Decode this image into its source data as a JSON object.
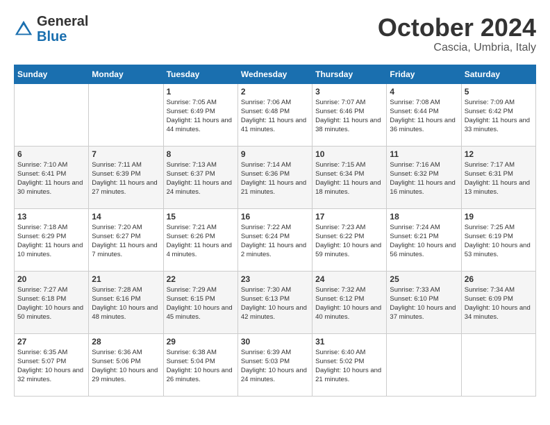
{
  "header": {
    "logo_general": "General",
    "logo_blue": "Blue",
    "month": "October 2024",
    "location": "Cascia, Umbria, Italy"
  },
  "weekdays": [
    "Sunday",
    "Monday",
    "Tuesday",
    "Wednesday",
    "Thursday",
    "Friday",
    "Saturday"
  ],
  "weeks": [
    [
      {
        "day": "",
        "info": ""
      },
      {
        "day": "",
        "info": ""
      },
      {
        "day": "1",
        "info": "Sunrise: 7:05 AM\nSunset: 6:49 PM\nDaylight: 11 hours and 44 minutes."
      },
      {
        "day": "2",
        "info": "Sunrise: 7:06 AM\nSunset: 6:48 PM\nDaylight: 11 hours and 41 minutes."
      },
      {
        "day": "3",
        "info": "Sunrise: 7:07 AM\nSunset: 6:46 PM\nDaylight: 11 hours and 38 minutes."
      },
      {
        "day": "4",
        "info": "Sunrise: 7:08 AM\nSunset: 6:44 PM\nDaylight: 11 hours and 36 minutes."
      },
      {
        "day": "5",
        "info": "Sunrise: 7:09 AM\nSunset: 6:42 PM\nDaylight: 11 hours and 33 minutes."
      }
    ],
    [
      {
        "day": "6",
        "info": "Sunrise: 7:10 AM\nSunset: 6:41 PM\nDaylight: 11 hours and 30 minutes."
      },
      {
        "day": "7",
        "info": "Sunrise: 7:11 AM\nSunset: 6:39 PM\nDaylight: 11 hours and 27 minutes."
      },
      {
        "day": "8",
        "info": "Sunrise: 7:13 AM\nSunset: 6:37 PM\nDaylight: 11 hours and 24 minutes."
      },
      {
        "day": "9",
        "info": "Sunrise: 7:14 AM\nSunset: 6:36 PM\nDaylight: 11 hours and 21 minutes."
      },
      {
        "day": "10",
        "info": "Sunrise: 7:15 AM\nSunset: 6:34 PM\nDaylight: 11 hours and 18 minutes."
      },
      {
        "day": "11",
        "info": "Sunrise: 7:16 AM\nSunset: 6:32 PM\nDaylight: 11 hours and 16 minutes."
      },
      {
        "day": "12",
        "info": "Sunrise: 7:17 AM\nSunset: 6:31 PM\nDaylight: 11 hours and 13 minutes."
      }
    ],
    [
      {
        "day": "13",
        "info": "Sunrise: 7:18 AM\nSunset: 6:29 PM\nDaylight: 11 hours and 10 minutes."
      },
      {
        "day": "14",
        "info": "Sunrise: 7:20 AM\nSunset: 6:27 PM\nDaylight: 11 hours and 7 minutes."
      },
      {
        "day": "15",
        "info": "Sunrise: 7:21 AM\nSunset: 6:26 PM\nDaylight: 11 hours and 4 minutes."
      },
      {
        "day": "16",
        "info": "Sunrise: 7:22 AM\nSunset: 6:24 PM\nDaylight: 11 hours and 2 minutes."
      },
      {
        "day": "17",
        "info": "Sunrise: 7:23 AM\nSunset: 6:22 PM\nDaylight: 10 hours and 59 minutes."
      },
      {
        "day": "18",
        "info": "Sunrise: 7:24 AM\nSunset: 6:21 PM\nDaylight: 10 hours and 56 minutes."
      },
      {
        "day": "19",
        "info": "Sunrise: 7:25 AM\nSunset: 6:19 PM\nDaylight: 10 hours and 53 minutes."
      }
    ],
    [
      {
        "day": "20",
        "info": "Sunrise: 7:27 AM\nSunset: 6:18 PM\nDaylight: 10 hours and 50 minutes."
      },
      {
        "day": "21",
        "info": "Sunrise: 7:28 AM\nSunset: 6:16 PM\nDaylight: 10 hours and 48 minutes."
      },
      {
        "day": "22",
        "info": "Sunrise: 7:29 AM\nSunset: 6:15 PM\nDaylight: 10 hours and 45 minutes."
      },
      {
        "day": "23",
        "info": "Sunrise: 7:30 AM\nSunset: 6:13 PM\nDaylight: 10 hours and 42 minutes."
      },
      {
        "day": "24",
        "info": "Sunrise: 7:32 AM\nSunset: 6:12 PM\nDaylight: 10 hours and 40 minutes."
      },
      {
        "day": "25",
        "info": "Sunrise: 7:33 AM\nSunset: 6:10 PM\nDaylight: 10 hours and 37 minutes."
      },
      {
        "day": "26",
        "info": "Sunrise: 7:34 AM\nSunset: 6:09 PM\nDaylight: 10 hours and 34 minutes."
      }
    ],
    [
      {
        "day": "27",
        "info": "Sunrise: 6:35 AM\nSunset: 5:07 PM\nDaylight: 10 hours and 32 minutes."
      },
      {
        "day": "28",
        "info": "Sunrise: 6:36 AM\nSunset: 5:06 PM\nDaylight: 10 hours and 29 minutes."
      },
      {
        "day": "29",
        "info": "Sunrise: 6:38 AM\nSunset: 5:04 PM\nDaylight: 10 hours and 26 minutes."
      },
      {
        "day": "30",
        "info": "Sunrise: 6:39 AM\nSunset: 5:03 PM\nDaylight: 10 hours and 24 minutes."
      },
      {
        "day": "31",
        "info": "Sunrise: 6:40 AM\nSunset: 5:02 PM\nDaylight: 10 hours and 21 minutes."
      },
      {
        "day": "",
        "info": ""
      },
      {
        "day": "",
        "info": ""
      }
    ]
  ]
}
